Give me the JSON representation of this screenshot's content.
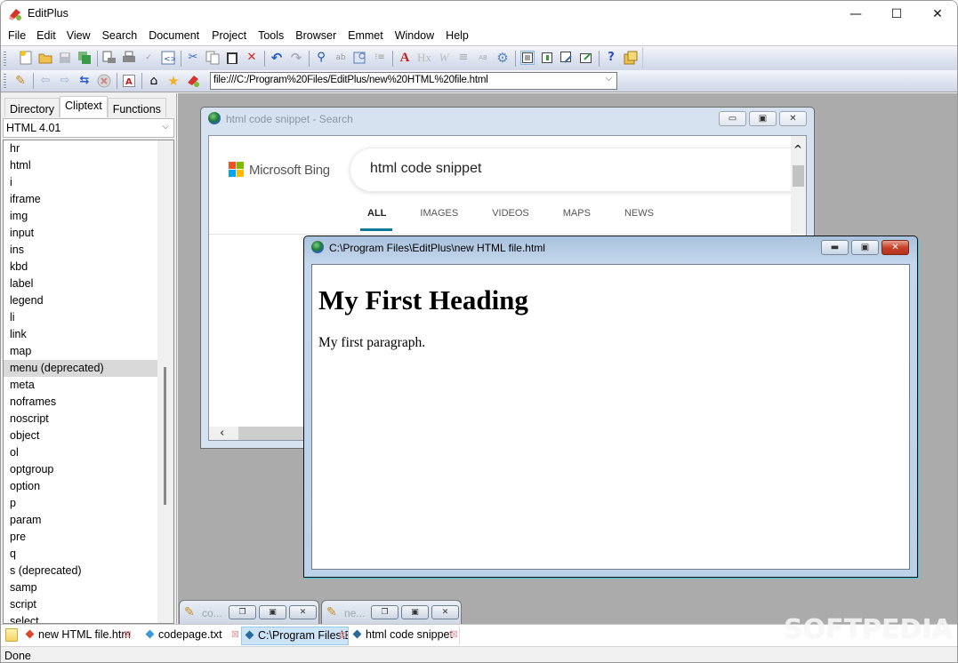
{
  "window": {
    "title": "EditPlus",
    "controls": {
      "minimize": "—",
      "maximize": "☐",
      "close": "✕"
    }
  },
  "menubar": [
    "File",
    "Edit",
    "View",
    "Search",
    "Document",
    "Project",
    "Tools",
    "Browser",
    "Emmet",
    "Window",
    "Help"
  ],
  "toolbar1": {
    "icons": [
      "new-file-icon",
      "open-folder-icon",
      "save-icon",
      "save-all-icon",
      "print-preview-icon",
      "print-icon",
      "spell-check-icon",
      "html-toolbar-icon",
      "cut-icon",
      "copy-icon",
      "paste-icon",
      "delete-icon",
      "undo-icon",
      "redo-icon",
      "find-icon",
      "replace-icon",
      "find-in-files-icon",
      "line-number-icon",
      "font-icon",
      "heading-icon",
      "word-wrap-icon",
      "indent-icon",
      "sort-icon",
      "settings-icon",
      "view-text-icon",
      "view-columns-icon",
      "view-link-icon",
      "view-external-icon",
      "help-icon",
      "clipboard-icon"
    ]
  },
  "toolbar2": {
    "icons": [
      "edit-pencil-icon",
      "back-icon",
      "forward-icon",
      "refresh-icon",
      "stop-icon",
      "acrobat-icon",
      "home-icon",
      "favorites-icon",
      "editplus-icon"
    ],
    "url": "file:///C:/Program%20Files/EditPlus/new%20HTML%20file.html"
  },
  "side_panel": {
    "tabs": [
      {
        "label": "Directory",
        "active": false
      },
      {
        "label": "Cliptext",
        "active": true
      },
      {
        "label": "Functions",
        "active": false
      }
    ],
    "category": "HTML 4.01",
    "items": [
      "hr",
      "html",
      "i",
      "iframe",
      "img",
      "input",
      "ins",
      "kbd",
      "label",
      "legend",
      "li",
      "link",
      "map",
      "menu (deprecated)",
      "meta",
      "noframes",
      "noscript",
      "object",
      "ol",
      "optgroup",
      "option",
      "p",
      "param",
      "pre",
      "q",
      "s (deprecated)",
      "samp",
      "script",
      "select"
    ],
    "selected_item": "menu (deprecated)"
  },
  "search_window": {
    "title": "html code snippet - Search",
    "brand": "Microsoft Bing",
    "query": "html code snippet",
    "tabs": [
      {
        "label": "ALL",
        "active": true
      },
      {
        "label": "IMAGES",
        "active": false
      },
      {
        "label": "VIDEOS",
        "active": false
      },
      {
        "label": "MAPS",
        "active": false
      },
      {
        "label": "NEWS",
        "active": false
      }
    ],
    "logo_colors": [
      "#f25022",
      "#7fba00",
      "#00a4ef",
      "#ffb900"
    ]
  },
  "html_window": {
    "title": "C:\\Program Files\\EditPlus\\new HTML file.html",
    "heading": "My First Heading",
    "paragraph": "My first paragraph."
  },
  "minimized_windows": [
    {
      "label": "co..."
    },
    {
      "label": "ne..."
    }
  ],
  "doc_tabs": [
    {
      "label": "new HTML file.htm",
      "dot_color": "#e0452a",
      "active": false
    },
    {
      "label": "codepage.txt",
      "dot_color": "#3a9ad9",
      "active": false
    },
    {
      "label": "C:\\Program Files\\E",
      "dot_color": "#2a6a9a",
      "active": true
    },
    {
      "label": "html code snippet",
      "dot_color": "#2a6a9a",
      "active": false
    }
  ],
  "status": {
    "text": "Done"
  },
  "watermark": "SOFTPEDIA"
}
